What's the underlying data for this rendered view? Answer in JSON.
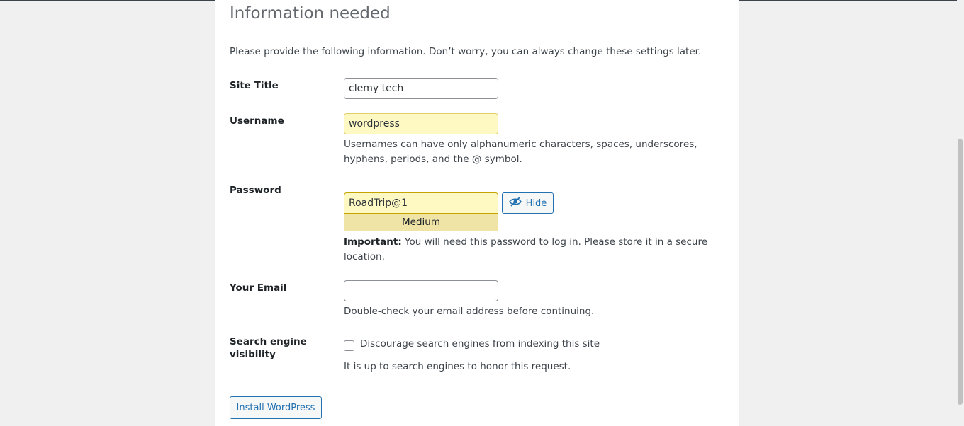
{
  "heading": "Information needed",
  "intro": "Please provide the following information. Don’t worry, you can always change these settings later.",
  "site_title": {
    "label": "Site Title",
    "value": "clemy tech"
  },
  "username": {
    "label": "Username",
    "value": "wordpress",
    "description": "Usernames can have only alphanumeric characters, spaces, underscores, hyphens, periods, and the @ symbol."
  },
  "password": {
    "label": "Password",
    "value": "RoadTrip@1",
    "hide_button_label": "Hide",
    "hide_button_icon": "eye-slash-icon",
    "strength": "Medium",
    "important_label": "Important:",
    "important_text": " You will need this password to log in. Please store it in a secure location."
  },
  "email": {
    "label": "Your Email",
    "value": "",
    "description": "Double-check your email address before continuing."
  },
  "search_visibility": {
    "label_line1": "Search engine",
    "label_line2": "visibility",
    "checkbox_label": "Discourage search engines from indexing this site",
    "checked": false,
    "description": "It is up to search engines to honor this request."
  },
  "install_button_label": "Install WordPress",
  "colors": {
    "accent": "#2271b1",
    "autofill": "#fef9c3",
    "strength_medium": "#f0e3a6"
  }
}
